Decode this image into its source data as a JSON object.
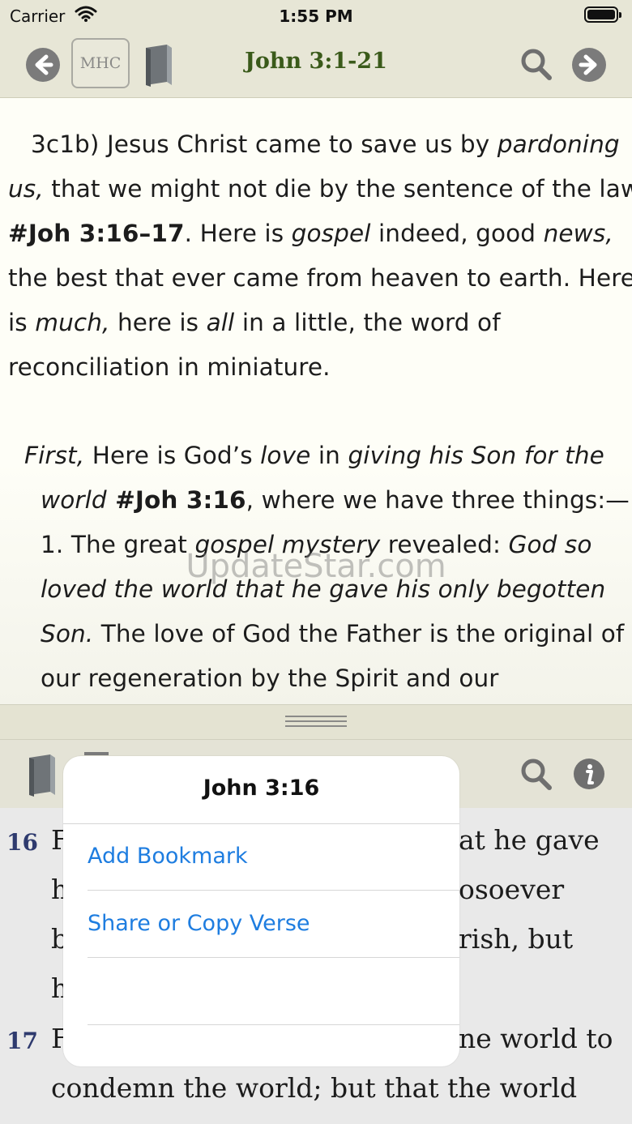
{
  "status_bar": {
    "carrier": "Carrier",
    "time": "1:55 PM"
  },
  "top_bar": {
    "mhc_label": "MHC",
    "reference_title": "John 3:1-21"
  },
  "commentary": {
    "line1": {
      "a": "3c1b) Jesus Christ came to save us by ",
      "b": "pardoning"
    },
    "line2": {
      "a": "us,",
      "b": " that we might not die by the sentence of the law,"
    },
    "line3": {
      "a": "#Joh 3:16–17",
      "b": ". Here is ",
      "c": "gospel",
      "d": " indeed, good ",
      "e": "news,"
    },
    "line4": "the best that ever came from heaven to earth. Here",
    "line5": {
      "a": "is ",
      "b": "much,",
      "c": " here is ",
      "d": "all",
      "e": " in a little, the word of"
    },
    "line6": "reconciliation in miniature.",
    "line7": {
      "a": "First,",
      "b": " Here is God’s ",
      "c": "love",
      "d": " in ",
      "e": "giving his Son for the"
    },
    "line8": {
      "a": "world",
      "b": " #Joh 3:16",
      "c": ", where we have three things:—"
    },
    "line9": {
      "a": "1. The great ",
      "b": "gospel mystery",
      "c": " revealed: ",
      "d": "God so"
    },
    "line10": "loved the world that he gave his only begotten",
    "line11": {
      "a": "Son.",
      "b": "  The love of God the Father is the original of"
    },
    "line12": "our regeneration by the Spirit and our",
    "watermark": "UpdateStar.com"
  },
  "bible": {
    "v16": {
      "number": "16",
      "lines": [
        "F",
        "at he gave",
        "h",
        "osoever",
        "b",
        "rish, but",
        "h"
      ]
    },
    "v17": {
      "number": "17",
      "lines": [
        "F",
        "ne world to",
        "condemn the world; but that the world"
      ]
    }
  },
  "popover": {
    "title": "John 3:16",
    "items": [
      "Add Bookmark",
      "Share or Copy Verse"
    ]
  }
}
